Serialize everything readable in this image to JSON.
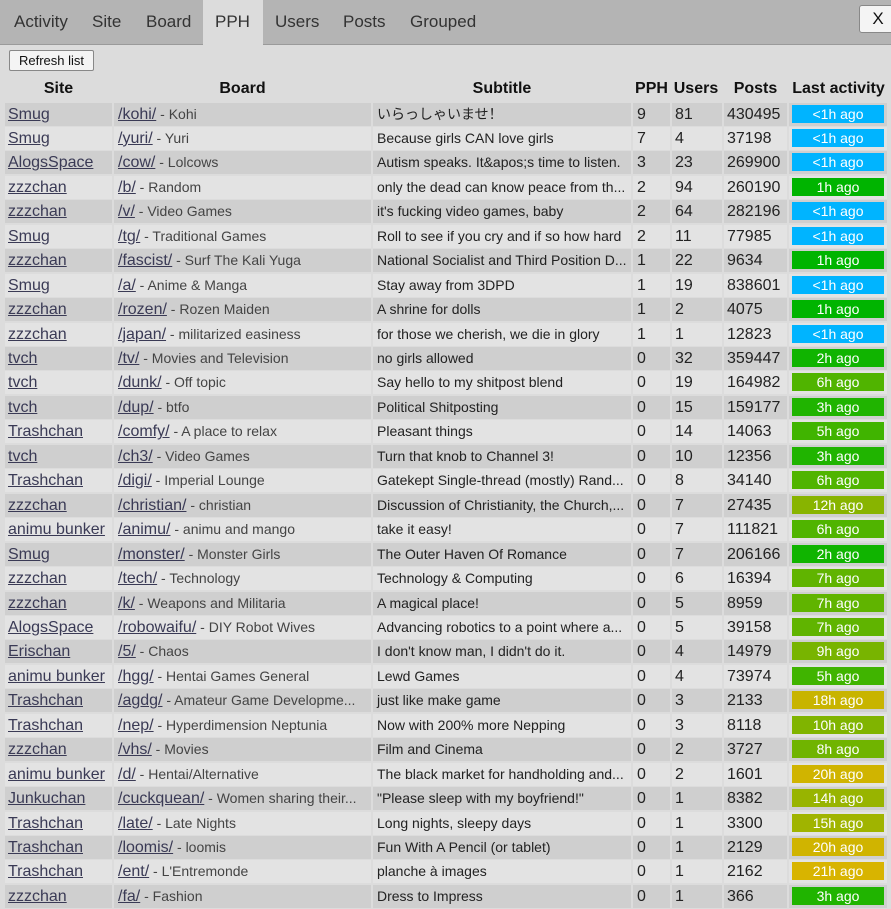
{
  "tabs": [
    {
      "label": "Activity",
      "active": false
    },
    {
      "label": "Site",
      "active": false
    },
    {
      "label": "Board",
      "active": false
    },
    {
      "label": "PPH",
      "active": true
    },
    {
      "label": "Users",
      "active": false
    },
    {
      "label": "Posts",
      "active": false
    },
    {
      "label": "Grouped",
      "active": false
    }
  ],
  "close_label": "X",
  "refresh_label": "Refresh list",
  "columns": {
    "site": "Site",
    "board": "Board",
    "subtitle": "Subtitle",
    "pph": "PPH",
    "users": "Users",
    "posts": "Posts",
    "last_activity": "Last activity"
  },
  "activity_colors": {
    "<1h ago": "#00b4ff",
    "1h ago": "#00b400",
    "2h ago": "#10b400",
    "3h ago": "#20b400",
    "5h ago": "#40b400",
    "6h ago": "#50b400",
    "7h ago": "#60b400",
    "8h ago": "#70b400",
    "9h ago": "#78b400",
    "10h ago": "#80b400",
    "12h ago": "#88b400",
    "14h ago": "#98b400",
    "15h ago": "#a0b400",
    "18h ago": "#c8b400",
    "20h ago": "#d0b400",
    "21h ago": "#d8b400",
    "3h ago?": "#20b400"
  },
  "rows": [
    {
      "site": "Smug",
      "board": "/kohi/",
      "desc": " - Kohi",
      "subtitle": "いらっしゃいませ！",
      "pph": "9",
      "users": "81",
      "posts": "430495",
      "activity": "<1h ago"
    },
    {
      "site": "Smug",
      "board": "/yuri/",
      "desc": " - Yuri",
      "subtitle": "Because girls CAN love girls",
      "pph": "7",
      "users": "4",
      "posts": "37198",
      "activity": "<1h ago"
    },
    {
      "site": "AlogsSpace",
      "board": "/cow/",
      "desc": " - Lolcows",
      "subtitle": "Autism speaks. It&apos;s time to listen.",
      "pph": "3",
      "users": "23",
      "posts": "269900",
      "activity": "<1h ago"
    },
    {
      "site": "zzzchan",
      "board": "/b/",
      "desc": " - Random",
      "subtitle": "only the dead can know peace from th...",
      "pph": "2",
      "users": "94",
      "posts": "260190",
      "activity": "1h ago"
    },
    {
      "site": "zzzchan",
      "board": "/v/",
      "desc": " - Video Games",
      "subtitle": "it's fucking video games, baby",
      "pph": "2",
      "users": "64",
      "posts": "282196",
      "activity": "<1h ago"
    },
    {
      "site": "Smug",
      "board": "/tg/",
      "desc": " - Traditional Games",
      "subtitle": "Roll to see if you cry and if so how hard",
      "pph": "2",
      "users": "11",
      "posts": "77985",
      "activity": "<1h ago"
    },
    {
      "site": "zzzchan",
      "board": "/fascist/",
      "desc": " - Surf The Kali Yuga",
      "subtitle": "National Socialist and Third Position D...",
      "pph": "1",
      "users": "22",
      "posts": "9634",
      "activity": "1h ago"
    },
    {
      "site": "Smug",
      "board": "/a/",
      "desc": " - Anime & Manga",
      "subtitle": "Stay away from 3DPD",
      "pph": "1",
      "users": "19",
      "posts": "838601",
      "activity": "<1h ago"
    },
    {
      "site": "zzzchan",
      "board": "/rozen/",
      "desc": " - Rozen Maiden",
      "subtitle": "A shrine for dolls",
      "pph": "1",
      "users": "2",
      "posts": "4075",
      "activity": "1h ago"
    },
    {
      "site": "zzzchan",
      "board": "/japan/",
      "desc": " - militarized easiness",
      "subtitle": "for those we cherish, we die in glory",
      "pph": "1",
      "users": "1",
      "posts": "12823",
      "activity": "<1h ago"
    },
    {
      "site": "tvch",
      "board": "/tv/",
      "desc": " - Movies and Television",
      "subtitle": "no girls allowed",
      "pph": "0",
      "users": "32",
      "posts": "359447",
      "activity": "2h ago"
    },
    {
      "site": "tvch",
      "board": "/dunk/",
      "desc": " - Off topic",
      "subtitle": "Say hello to my shitpost blend",
      "pph": "0",
      "users": "19",
      "posts": "164982",
      "activity": "6h ago"
    },
    {
      "site": "tvch",
      "board": "/dup/",
      "desc": " - btfo",
      "subtitle": "Political Shitposting",
      "pph": "0",
      "users": "15",
      "posts": "159177",
      "activity": "3h ago"
    },
    {
      "site": "Trashchan",
      "board": "/comfy/",
      "desc": " - A place to relax",
      "subtitle": "Pleasant things",
      "pph": "0",
      "users": "14",
      "posts": "14063",
      "activity": "5h ago"
    },
    {
      "site": "tvch",
      "board": "/ch3/",
      "desc": " - Video Games",
      "subtitle": "Turn that knob to Channel 3!",
      "pph": "0",
      "users": "10",
      "posts": "12356",
      "activity": "3h ago"
    },
    {
      "site": "Trashchan",
      "board": "/digi/",
      "desc": " - Imperial Lounge",
      "subtitle": "Gatekept Single-thread (mostly) Rand...",
      "pph": "0",
      "users": "8",
      "posts": "34140",
      "activity": "6h ago"
    },
    {
      "site": "zzzchan",
      "board": "/christian/",
      "desc": " - christian",
      "subtitle": "Discussion of Christianity, the Church,...",
      "pph": "0",
      "users": "7",
      "posts": "27435",
      "activity": "12h ago"
    },
    {
      "site": "animu bunker",
      "board": "/animu/",
      "desc": " - animu and mango",
      "subtitle": "take it easy!",
      "pph": "0",
      "users": "7",
      "posts": "111821",
      "activity": "6h ago"
    },
    {
      "site": "Smug",
      "board": "/monster/",
      "desc": " - Monster Girls",
      "subtitle": "The Outer Haven Of Romance",
      "pph": "0",
      "users": "7",
      "posts": "206166",
      "activity": "2h ago"
    },
    {
      "site": "zzzchan",
      "board": "/tech/",
      "desc": " - Technology",
      "subtitle": "Technology & Computing",
      "pph": "0",
      "users": "6",
      "posts": "16394",
      "activity": "7h ago"
    },
    {
      "site": "zzzchan",
      "board": "/k/",
      "desc": " - Weapons and Militaria",
      "subtitle": "A magical place!",
      "pph": "0",
      "users": "5",
      "posts": "8959",
      "activity": "7h ago"
    },
    {
      "site": "AlogsSpace",
      "board": "/robowaifu/",
      "desc": " - DIY Robot Wives",
      "subtitle": "Advancing robotics to a point where a...",
      "pph": "0",
      "users": "5",
      "posts": "39158",
      "activity": "7h ago"
    },
    {
      "site": "Erischan",
      "board": "/5/",
      "desc": " - Chaos",
      "subtitle": "I don't know man, I didn't do it.",
      "pph": "0",
      "users": "4",
      "posts": "14979",
      "activity": "9h ago"
    },
    {
      "site": "animu bunker",
      "board": "/hgg/",
      "desc": " - Hentai Games General",
      "subtitle": "Lewd Games",
      "pph": "0",
      "users": "4",
      "posts": "73974",
      "activity": "5h ago"
    },
    {
      "site": "Trashchan",
      "board": "/agdg/",
      "desc": " - Amateur Game Developme...",
      "subtitle": "just like make game",
      "pph": "0",
      "users": "3",
      "posts": "2133",
      "activity": "18h ago"
    },
    {
      "site": "Trashchan",
      "board": "/nep/",
      "desc": " - Hyperdimension Neptunia",
      "subtitle": "Now with 200% more Nepping",
      "pph": "0",
      "users": "3",
      "posts": "8118",
      "activity": "10h ago"
    },
    {
      "site": "zzzchan",
      "board": "/vhs/",
      "desc": " - Movies",
      "subtitle": "Film and Cinema",
      "pph": "0",
      "users": "2",
      "posts": "3727",
      "activity": "8h ago"
    },
    {
      "site": "animu bunker",
      "board": "/d/",
      "desc": " - Hentai/Alternative",
      "subtitle": "The black market for handholding and...",
      "pph": "0",
      "users": "2",
      "posts": "1601",
      "activity": "20h ago"
    },
    {
      "site": "Junkuchan",
      "board": "/cuckquean/",
      "desc": " - Women sharing their...",
      "subtitle": "\"Please sleep with my boyfriend!\"",
      "pph": "0",
      "users": "1",
      "posts": "8382",
      "activity": "14h ago"
    },
    {
      "site": "Trashchan",
      "board": "/late/",
      "desc": " - Late Nights",
      "subtitle": "Long nights, sleepy days",
      "pph": "0",
      "users": "1",
      "posts": "3300",
      "activity": "15h ago"
    },
    {
      "site": "Trashchan",
      "board": "/loomis/",
      "desc": " - loomis",
      "subtitle": "Fun With A Pencil (or tablet)",
      "pph": "0",
      "users": "1",
      "posts": "2129",
      "activity": "20h ago"
    },
    {
      "site": "Trashchan",
      "board": "/ent/",
      "desc": " - L'Entremonde",
      "subtitle": "planche à images",
      "pph": "0",
      "users": "1",
      "posts": "2162",
      "activity": "21h ago"
    },
    {
      "site": "zzzchan",
      "board": "/fa/",
      "desc": " - Fashion",
      "subtitle": "Dress to Impress",
      "pph": "0",
      "users": "1",
      "posts": "366",
      "activity": "3h ago"
    }
  ]
}
